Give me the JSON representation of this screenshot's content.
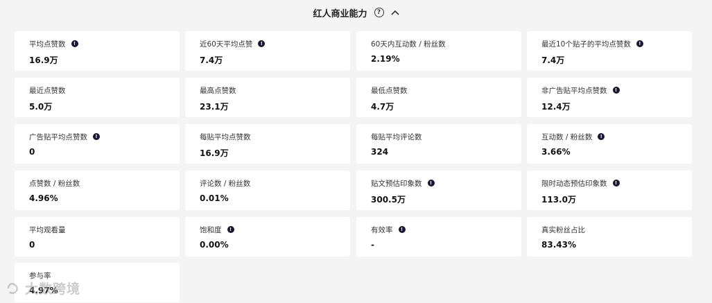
{
  "section": {
    "title": "红人商业能力"
  },
  "metrics": [
    {
      "label": "平均点赞数",
      "value": "16.9万",
      "info": true
    },
    {
      "label": "近60天平均点赞",
      "value": "7.4万",
      "info": true
    },
    {
      "label": "60天内互动数 / 粉丝数",
      "value": "2.19%",
      "info": false
    },
    {
      "label": "最近10个贴子的平均点赞数",
      "value": "7.4万",
      "info": true
    },
    {
      "label": "最近点赞数",
      "value": "5.0万",
      "info": false
    },
    {
      "label": "最高点赞数",
      "value": "23.1万",
      "info": false
    },
    {
      "label": "最低点赞数",
      "value": "4.7万",
      "info": false
    },
    {
      "label": "非广告贴平均点赞数",
      "value": "12.4万",
      "info": true
    },
    {
      "label": "广告贴平均点赞数",
      "value": "0",
      "info": true
    },
    {
      "label": "每贴平均点赞数",
      "value": "16.9万",
      "info": false
    },
    {
      "label": "每贴平均评论数",
      "value": "324",
      "info": false
    },
    {
      "label": "互动数 / 粉丝数",
      "value": "3.66%",
      "info": true
    },
    {
      "label": "点赞数 / 粉丝数",
      "value": "4.96%",
      "info": false
    },
    {
      "label": "评论数 / 粉丝数",
      "value": "0.01%",
      "info": false
    },
    {
      "label": "贴文预估印象数",
      "value": "300.5万",
      "info": true
    },
    {
      "label": "限时动态预估印象数",
      "value": "113.0万",
      "info": true
    },
    {
      "label": "平均观看量",
      "value": "0",
      "info": false
    },
    {
      "label": "饱和度",
      "value": "0.00%",
      "info": true
    },
    {
      "label": "有效率",
      "value": "-",
      "info": true
    },
    {
      "label": "真实粉丝占比",
      "value": "83.43%",
      "info": false
    },
    {
      "label": "参与率",
      "value": "4.97%",
      "info": false
    }
  ],
  "watermark": {
    "text": "大数跨境"
  },
  "icons": {
    "help": "question-circle-icon",
    "collapse": "chevron-up-icon",
    "info": "info-circle-icon"
  }
}
